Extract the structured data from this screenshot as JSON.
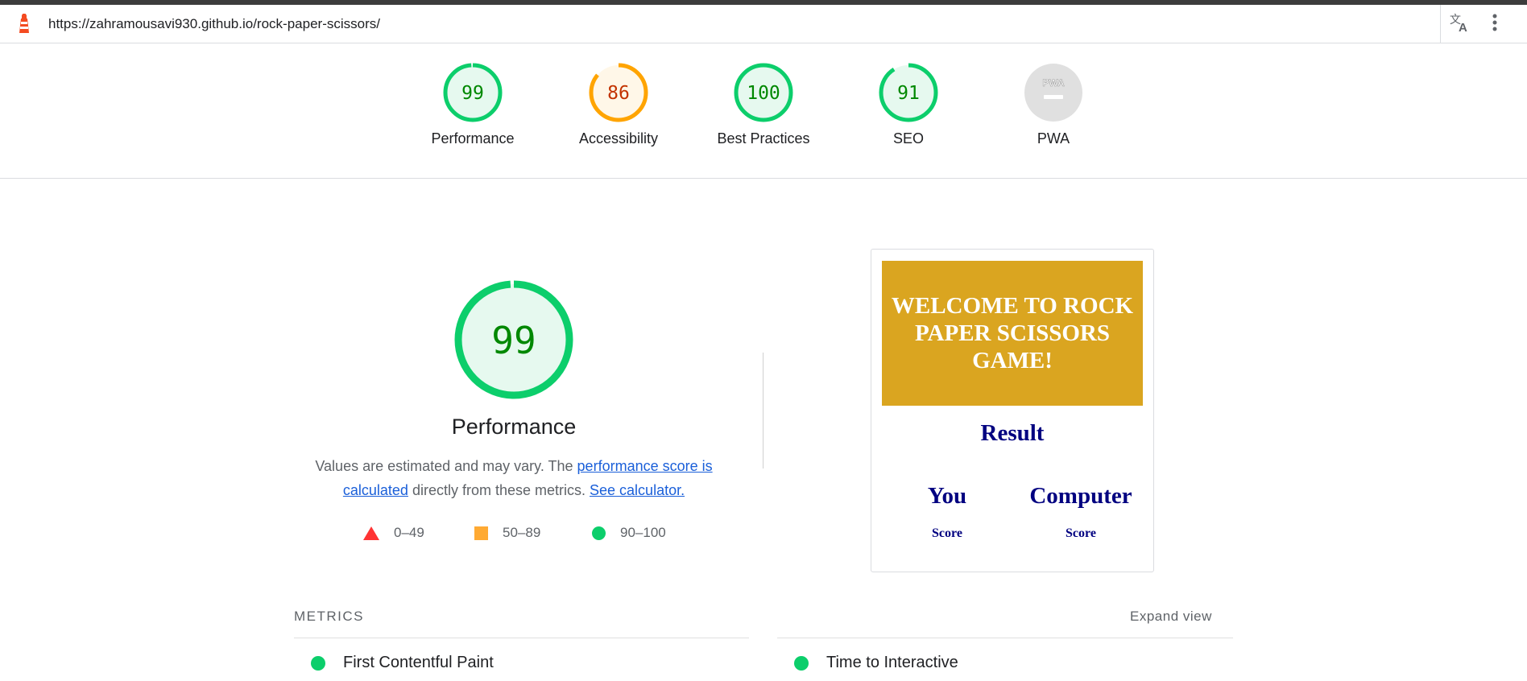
{
  "browser": {
    "url": "https://zahramousavi930.github.io/rock-paper-scissors/",
    "icons": {
      "site": "lighthouse-icon",
      "translate": "translate-icon",
      "menu": "more-vert-icon"
    }
  },
  "scores": [
    {
      "label": "Performance",
      "value": "99",
      "fraction": 0.99,
      "status": "pass"
    },
    {
      "label": "Accessibility",
      "value": "86",
      "fraction": 0.86,
      "status": "average"
    },
    {
      "label": "Best Practices",
      "value": "100",
      "fraction": 1.0,
      "status": "pass"
    },
    {
      "label": "SEO",
      "value": "91",
      "fraction": 0.91,
      "status": "pass"
    },
    {
      "label": "PWA",
      "value": "PWA",
      "status": "na"
    }
  ],
  "colors": {
    "pass": "#0cce6b",
    "pass_text": "#008800",
    "pass_bg": "#e6f9ef",
    "average": "#ffa400",
    "average_text": "#c33300",
    "average_bg": "#fff7e8",
    "fail": "#ff3333",
    "na": "#e0e0e0"
  },
  "performance": {
    "score": "99",
    "fraction": 0.99,
    "title": "Performance",
    "desc_pre": "Values are estimated and may vary. The ",
    "link_score": "performance score is calculated",
    "desc_mid": " directly from these metrics. ",
    "link_calc": "See calculator."
  },
  "legend": [
    {
      "range": "0–49",
      "shape": "triangle"
    },
    {
      "range": "50–89",
      "shape": "square"
    },
    {
      "range": "90–100",
      "shape": "circle"
    }
  ],
  "screenshot": {
    "banner": "WELCOME TO ROCK PAPER SCISSORS GAME!",
    "banner_color": "#daa520",
    "text_color": "#000080",
    "result": "Result",
    "player_you": "You",
    "player_computer": "Computer",
    "score_label": "Score"
  },
  "metrics": {
    "header": "METRICS",
    "expand": "Expand view",
    "items": [
      "First Contentful Paint",
      "Time to Interactive"
    ]
  }
}
